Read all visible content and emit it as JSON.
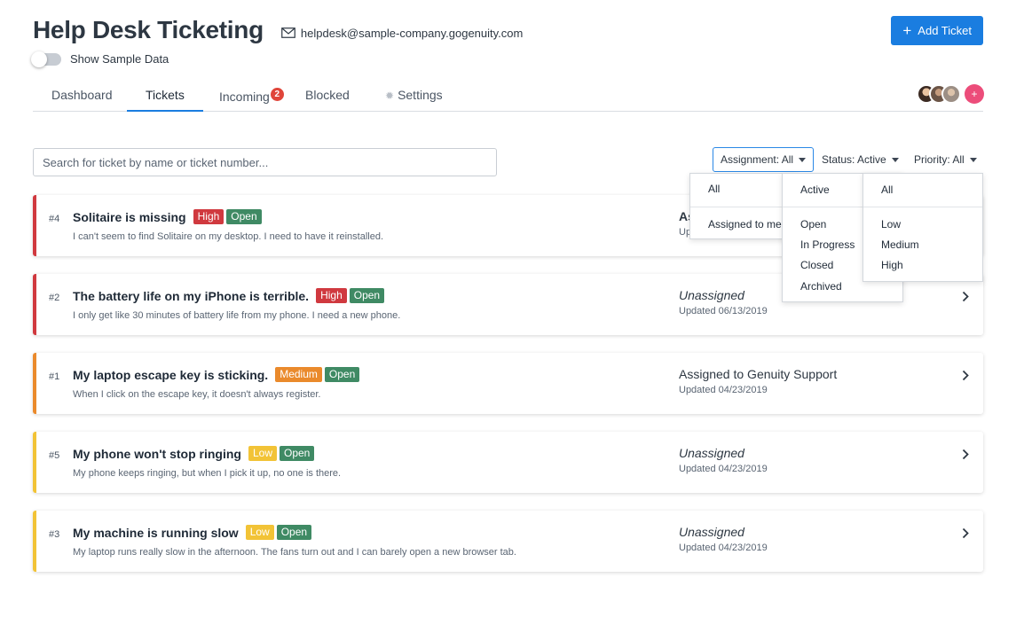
{
  "header": {
    "title": "Help Desk Ticketing",
    "email": "helpdesk@sample-company.gogenuity.com",
    "sample_toggle_label": "Show Sample Data",
    "add_ticket_label": "Add Ticket"
  },
  "tabs": [
    {
      "label": "Dashboard"
    },
    {
      "label": "Tickets",
      "active": true
    },
    {
      "label": "Incoming",
      "badge": "2"
    },
    {
      "label": "Blocked"
    },
    {
      "label": "Settings",
      "icon": "gear-icon"
    }
  ],
  "search": {
    "placeholder": "Search for ticket by name or ticket number..."
  },
  "filters": {
    "assignment": {
      "label": "Assignment: All",
      "options": [
        "All",
        "Assigned to me"
      ]
    },
    "status": {
      "label": "Status: Active",
      "options": [
        "Active",
        "Open",
        "In Progress",
        "Closed",
        "Archived"
      ]
    },
    "priority": {
      "label": "Priority: All",
      "options": [
        "All",
        "Low",
        "Medium",
        "High"
      ]
    }
  },
  "colors": {
    "accent": "#1a7de0",
    "high": "#d0393f",
    "medium": "#ea8a2c",
    "low": "#f2c336",
    "open": "#3f8a64"
  },
  "tickets": [
    {
      "number": "#4",
      "title": "Solitaire is missing",
      "priority": "High",
      "status": "Open",
      "description": "I can't seem to find Solitaire on my desktop.  I need to have it reinstalled.",
      "assignee": "As",
      "updated": "Up"
    },
    {
      "number": "#2",
      "title": "The battery life on my iPhone is terrible.",
      "priority": "High",
      "status": "Open",
      "description": "I only get like 30 minutes of battery life from my phone.  I need a new phone.",
      "assignee": "Unassigned",
      "updated": "Updated 06/13/2019"
    },
    {
      "number": "#1",
      "title": "My laptop escape key is sticking.",
      "priority": "Medium",
      "status": "Open",
      "description": "When I click on the escape key, it doesn't always register.",
      "assignee": "Assigned to Genuity Support",
      "updated": "Updated 04/23/2019"
    },
    {
      "number": "#5",
      "title": "My phone won't stop ringing",
      "priority": "Low",
      "status": "Open",
      "description": "My phone keeps ringing, but when I pick it up, no one is there.",
      "assignee": "Unassigned",
      "updated": "Updated 04/23/2019"
    },
    {
      "number": "#3",
      "title": "My machine is running slow",
      "priority": "Low",
      "status": "Open",
      "description": "My laptop runs really slow in the afternoon.  The fans turn out and I can barely open a new browser tab.",
      "assignee": "Unassigned",
      "updated": "Updated 04/23/2019"
    }
  ]
}
